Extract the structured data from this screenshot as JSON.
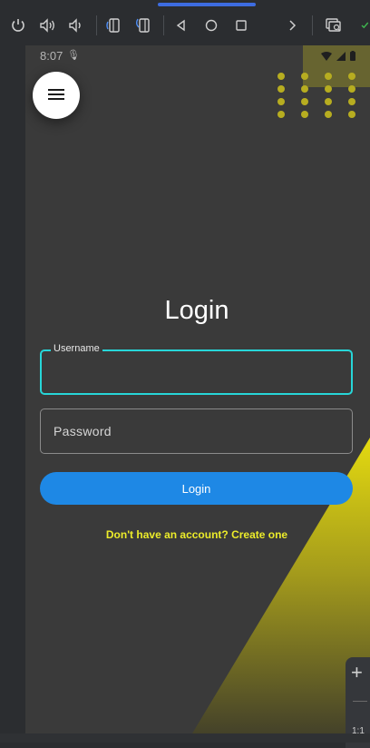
{
  "toolbar": {
    "icons": [
      "power-icon",
      "volume-up-icon",
      "volume-down-icon",
      "rotate-left-icon",
      "rotate-right-icon",
      "back-icon",
      "home-icon",
      "overview-icon",
      "chevron-right-icon",
      "screenshot-search-icon",
      "check-icon"
    ]
  },
  "status_bar": {
    "time": "8:07",
    "icons": [
      "mic-icon",
      "wifi-icon",
      "signal-icon",
      "battery-icon"
    ]
  },
  "app": {
    "menu_icon": "menu-icon",
    "title": "Login",
    "username": {
      "label": "Username",
      "value": ""
    },
    "password": {
      "placeholder": "Password",
      "value": ""
    },
    "login_button": "Login",
    "signup_link": "Don't have an account? Create one"
  },
  "side_panel": {
    "zoom_in": "+",
    "ratio": "1:1"
  },
  "colors": {
    "accent_blue": "#1e88e5",
    "focus_cyan": "#27d6d8",
    "link_yellow": "#ecec2a",
    "background": "#3a3a3a"
  }
}
